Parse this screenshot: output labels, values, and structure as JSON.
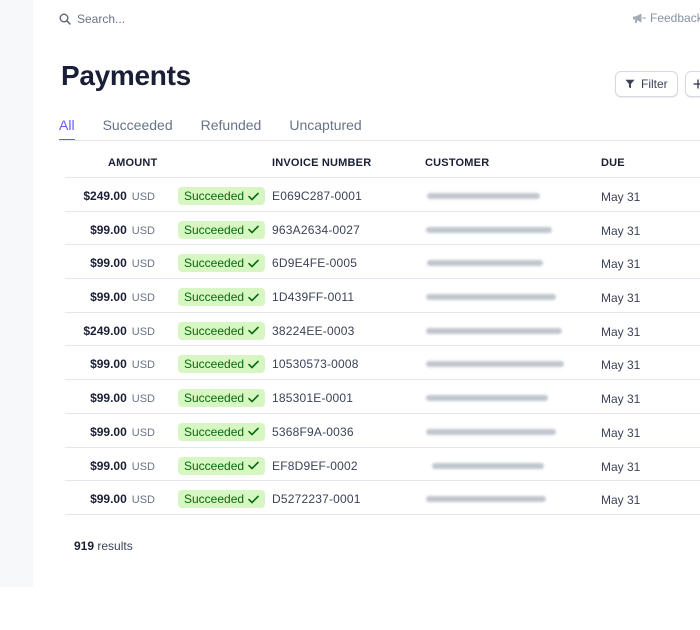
{
  "search": {
    "placeholder": "Search..."
  },
  "header": {
    "feedback_label": "Feedback"
  },
  "page": {
    "title": "Payments"
  },
  "actions": {
    "filter_label": "Filter"
  },
  "tabs": [
    {
      "label": "All",
      "active": true
    },
    {
      "label": "Succeeded",
      "active": false
    },
    {
      "label": "Refunded",
      "active": false
    },
    {
      "label": "Uncaptured",
      "active": false
    }
  ],
  "table": {
    "columns": {
      "amount": "AMOUNT",
      "invoice": "INVOICE NUMBER",
      "customer": "CUSTOMER",
      "due": "DUE"
    },
    "rows": [
      {
        "amount": "$249.00",
        "currency": "USD",
        "status": "Succeeded",
        "invoice": "E069C287-0001",
        "due": "May 31"
      },
      {
        "amount": "$99.00",
        "currency": "USD",
        "status": "Succeeded",
        "invoice": "963A2634-0027",
        "due": "May 31"
      },
      {
        "amount": "$99.00",
        "currency": "USD",
        "status": "Succeeded",
        "invoice": "6D9E4FE-0005",
        "due": "May 31"
      },
      {
        "amount": "$99.00",
        "currency": "USD",
        "status": "Succeeded",
        "invoice": "1D439FF-0011",
        "due": "May 31"
      },
      {
        "amount": "$249.00",
        "currency": "USD",
        "status": "Succeeded",
        "invoice": "38224EE-0003",
        "due": "May 31"
      },
      {
        "amount": "$99.00",
        "currency": "USD",
        "status": "Succeeded",
        "invoice": "10530573-0008",
        "due": "May 31"
      },
      {
        "amount": "$99.00",
        "currency": "USD",
        "status": "Succeeded",
        "invoice": "185301E-0001",
        "due": "May 31"
      },
      {
        "amount": "$99.00",
        "currency": "USD",
        "status": "Succeeded",
        "invoice": "5368F9A-0036",
        "due": "May 31"
      },
      {
        "amount": "$99.00",
        "currency": "USD",
        "status": "Succeeded",
        "invoice": "EF8D9EF-0002",
        "due": "May 31"
      },
      {
        "amount": "$99.00",
        "currency": "USD",
        "status": "Succeeded",
        "invoice": "D5272237-0001",
        "due": "May 31"
      }
    ]
  },
  "footer": {
    "results_count": "919",
    "results_label": "results"
  },
  "colors": {
    "accent": "#635bff",
    "success_bg": "#d7f7c2",
    "success_text": "#05690d",
    "text_primary": "#1a1f36",
    "text_muted": "#697386",
    "divider": "#e3e8ee"
  },
  "icons": {
    "search": "search-icon",
    "feedback": "megaphone-icon",
    "filter": "filter-icon",
    "add": "plus-icon",
    "status": "check-icon"
  }
}
